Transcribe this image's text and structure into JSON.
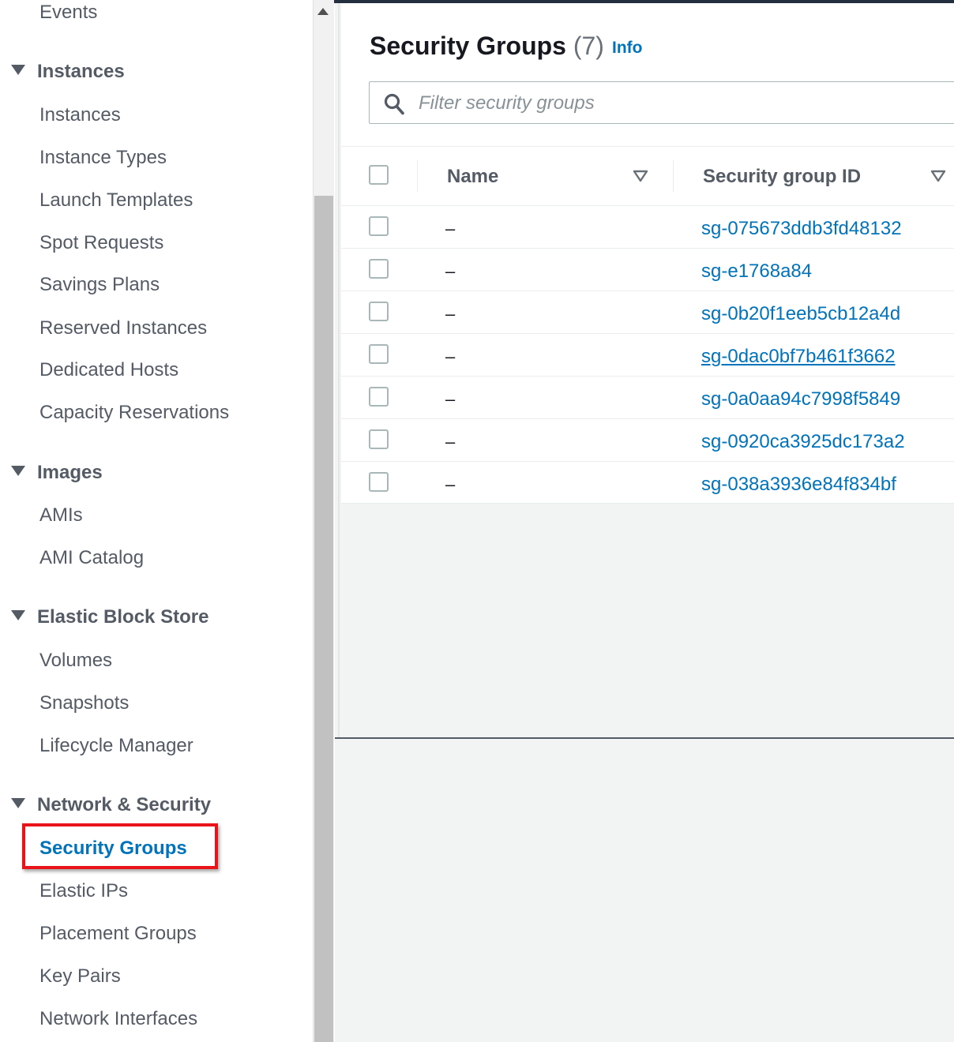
{
  "sidebar": {
    "top_item": "Events",
    "sections": [
      {
        "title": "Instances",
        "items": [
          "Instances",
          "Instance Types",
          "Launch Templates",
          "Spot Requests",
          "Savings Plans",
          "Reserved Instances",
          "Dedicated Hosts",
          "Capacity Reservations"
        ]
      },
      {
        "title": "Images",
        "items": [
          "AMIs",
          "AMI Catalog"
        ]
      },
      {
        "title": "Elastic Block Store",
        "items": [
          "Volumes",
          "Snapshots",
          "Lifecycle Manager"
        ]
      },
      {
        "title": "Network & Security",
        "items": [
          "Security Groups",
          "Elastic IPs",
          "Placement Groups",
          "Key Pairs",
          "Network Interfaces"
        ]
      }
    ],
    "active_item": "Security Groups"
  },
  "main": {
    "title": "Security Groups",
    "count": "(7)",
    "info_label": "Info",
    "search_placeholder": "Filter security groups",
    "columns": [
      "Name",
      "Security group ID"
    ],
    "rows": [
      {
        "name": "–",
        "id": "sg-075673ddb3fd48132"
      },
      {
        "name": "–",
        "id": "sg-e1768a84"
      },
      {
        "name": "–",
        "id": "sg-0b20f1eeb5cb12a4d"
      },
      {
        "name": "–",
        "id": "sg-0dac0bf7b461f3662"
      },
      {
        "name": "–",
        "id": "sg-0a0aa94c7998f5849"
      },
      {
        "name": "–",
        "id": "sg-0920ca3925dc173a2"
      },
      {
        "name": "–",
        "id": "sg-038a3936e84f834bf"
      }
    ]
  },
  "colors": {
    "link": "#0073bb",
    "highlight": "#e8141a",
    "text": "#545b64"
  },
  "icons": [
    "search-icon",
    "caret-down-icon",
    "sort-icon",
    "scroll-up-icon"
  ]
}
